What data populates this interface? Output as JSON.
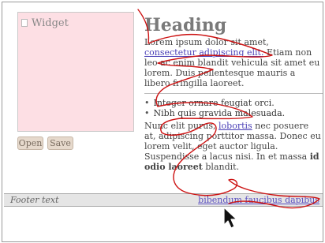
{
  "widget": {
    "title": "Widget",
    "icon": "document-icon"
  },
  "buttons": {
    "open_label": "Open",
    "save_label": "Save"
  },
  "content": {
    "heading": "Heading",
    "para1_pre": "Lorem ipsum dolor sit amet, ",
    "para1_link": "consectetur adipiscing elit.",
    "para1_post": " Etiam non leo ac enim blandit vehicula sit amet eu lorem. Duis pellentesque mauris a libero fringilla laoreet.",
    "list": [
      "Integer ornare feugiat orci.",
      "Nibh quis gravida malesuada."
    ],
    "para2_pre": "Nunc elit purus, ",
    "para2_link": "lobortis",
    "para2_mid": " nec posuere at, adipiscing porttitor massa. Donec eu lorem velit, eget auctor ligula. Suspendisse a lacus nisi. In et massa ",
    "para2_bold": "id odio laoreet",
    "para2_post": " blandit."
  },
  "footer": {
    "text": "Footer text",
    "link": "bibendum faucibus dapibus"
  },
  "colors": {
    "widget_bg": "#fddfe4",
    "scribble": "#cc1111",
    "link": "#4a3fb6"
  },
  "icons": {
    "cursor": "mouse-pointer-icon"
  }
}
